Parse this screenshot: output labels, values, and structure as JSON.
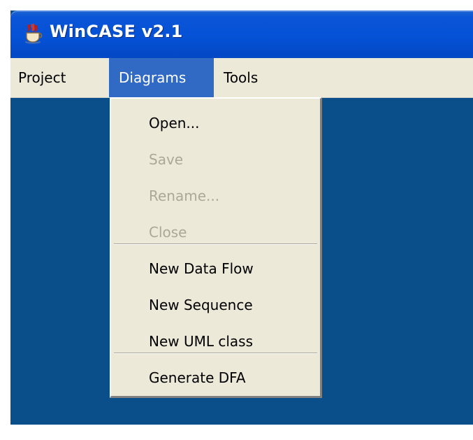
{
  "window": {
    "title": "WinCASE v2.1",
    "app_icon": "java-icon",
    "colors": {
      "titlebar": "#0552d6",
      "desktop": "#0a4f8a",
      "menu_highlight": "#316ac5",
      "menu_background": "#ece9d8",
      "disabled_text": "#aca899"
    }
  },
  "menubar": {
    "items": [
      {
        "label": "Project"
      },
      {
        "label": "Diagrams",
        "state": "open"
      },
      {
        "label": "Tools"
      }
    ]
  },
  "diagrams_menu": {
    "groups": [
      [
        {
          "label": "Open...",
          "enabled": true
        },
        {
          "label": "Save",
          "enabled": false
        },
        {
          "label": "Rename...",
          "enabled": false
        },
        {
          "label": "Close",
          "enabled": false
        }
      ],
      [
        {
          "label": "New Data Flow",
          "enabled": true
        },
        {
          "label": "New Sequence",
          "enabled": true
        },
        {
          "label": "New UML class",
          "enabled": true
        }
      ],
      [
        {
          "label": "Generate DFA",
          "enabled": true
        }
      ]
    ]
  }
}
